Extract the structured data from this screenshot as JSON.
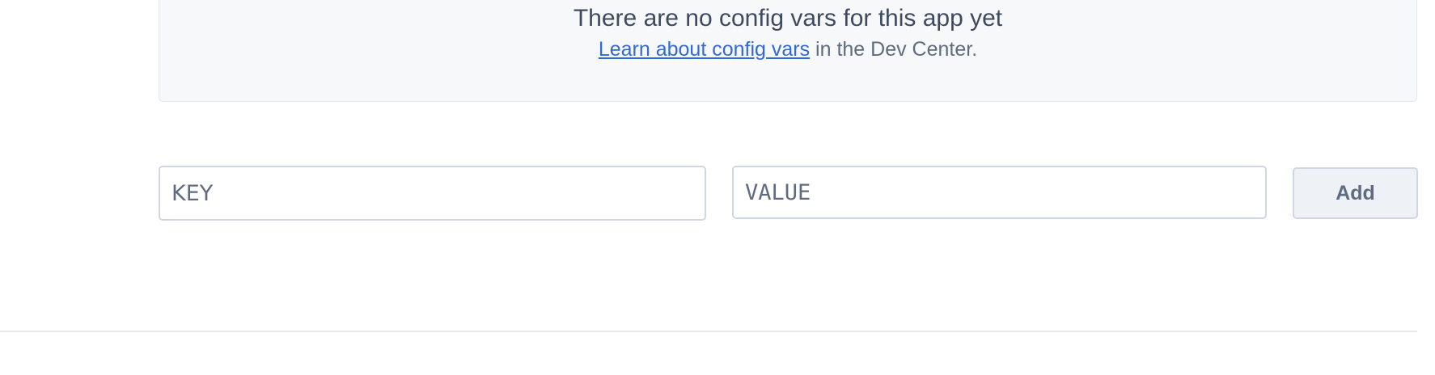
{
  "empty_state": {
    "title": "There are no config vars for this app yet",
    "link_text": "Learn about config vars",
    "suffix_text": " in the Dev Center."
  },
  "form": {
    "key_placeholder": "KEY",
    "value_placeholder": "VALUE",
    "add_label": "Add"
  },
  "colors": {
    "link": "#3169d6",
    "panel_bg": "#f7f8fa",
    "text": "#3f4a5f",
    "muted_text": "#5f6b80",
    "border": "#cfd6e4"
  }
}
